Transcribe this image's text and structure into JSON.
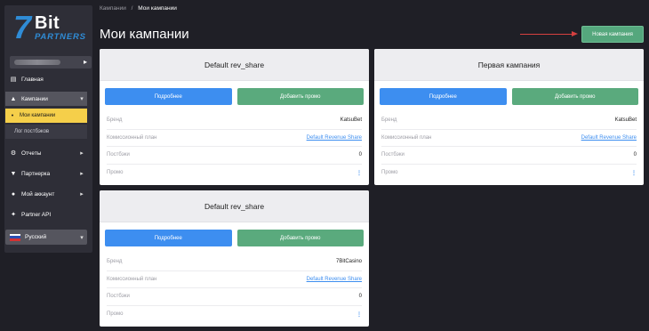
{
  "logo": {
    "seven": "7",
    "bit": "Bit",
    "partners": "PARTNERS"
  },
  "sidebar": {
    "user_arrow": "▸",
    "items": [
      {
        "label": "Главная",
        "icon": "home-icon"
      },
      {
        "label": "Кампании",
        "icon": "campaigns-icon",
        "expanded": true
      },
      {
        "label": "Отчеты",
        "icon": "reports-icon"
      },
      {
        "label": "Партнерка",
        "icon": "partners-icon"
      },
      {
        "label": "Мой аккаунт",
        "icon": "account-icon"
      },
      {
        "label": "Partner API",
        "icon": "api-icon"
      }
    ],
    "sub_items": [
      {
        "label": "Мои кампании",
        "active": true
      },
      {
        "label": "Лог постбэков",
        "active": false
      }
    ],
    "language": "Русский"
  },
  "breadcrumb": {
    "parent": "Кампании",
    "separator": "/",
    "current": "Мои кампании"
  },
  "page_title": "Мои кампании",
  "new_campaign_button": "Новая кампания",
  "accent_color": "#f5cf4a",
  "cards": [
    {
      "title": "Default rev_share",
      "details_button": "Подробнее",
      "add_promo_button": "Добавить промо",
      "rows": [
        {
          "key": "Бренд",
          "value": "KatsuBet"
        },
        {
          "key": "Комиссионный план",
          "value": "Default Revenue Share"
        },
        {
          "key": "Постбэки",
          "value": "0"
        },
        {
          "key": "Промо",
          "value": "⋮"
        }
      ]
    },
    {
      "title": "Первая кампания",
      "details_button": "Подробнее",
      "add_promo_button": "Добавить промо",
      "rows": [
        {
          "key": "Бренд",
          "value": "KatsuBet"
        },
        {
          "key": "Комиссионный план",
          "value": "Default Revenue Share"
        },
        {
          "key": "Постбэки",
          "value": "0"
        },
        {
          "key": "Промо",
          "value": "⋮"
        }
      ]
    },
    {
      "title": "Default rev_share",
      "details_button": "Подробнее",
      "add_promo_button": "Добавить промо",
      "rows": [
        {
          "key": "Бренд",
          "value": "7BitCasino"
        },
        {
          "key": "Комиссионный план",
          "value": "Default Revenue Share"
        },
        {
          "key": "Постбэки",
          "value": "0"
        },
        {
          "key": "Промо",
          "value": "⋮"
        }
      ]
    }
  ]
}
